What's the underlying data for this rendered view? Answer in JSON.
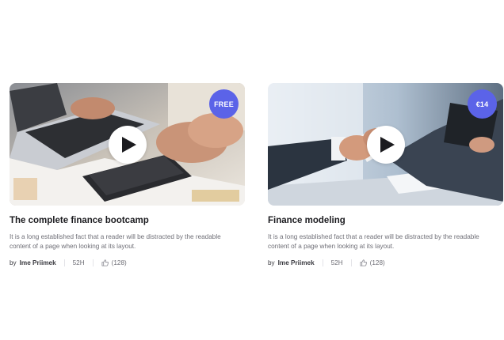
{
  "courses": [
    {
      "badge": "FREE",
      "title": "The complete finance bootcamp",
      "description": "It is a long established fact that a reader will be distracted by the readable content of a page when looking at its layout.",
      "by_label": "by",
      "author": "Ime Priimek",
      "duration": "52H",
      "likes": "(128)",
      "image_icon": "laptop-calculator-photo",
      "play_icon": "play-icon"
    },
    {
      "badge": "€14",
      "title": "Finance modeling",
      "description": "It is a long established fact that a reader will be distracted by the readable content of a page when looking at its layout.",
      "by_label": "by",
      "author": "Ime Priimek",
      "duration": "52H",
      "likes": "(128)",
      "image_icon": "handshake-photo",
      "play_icon": "play-icon"
    }
  ],
  "colors": {
    "badge": "#5b63e8",
    "title": "#1b1b1f",
    "muted": "#6e6e76"
  }
}
